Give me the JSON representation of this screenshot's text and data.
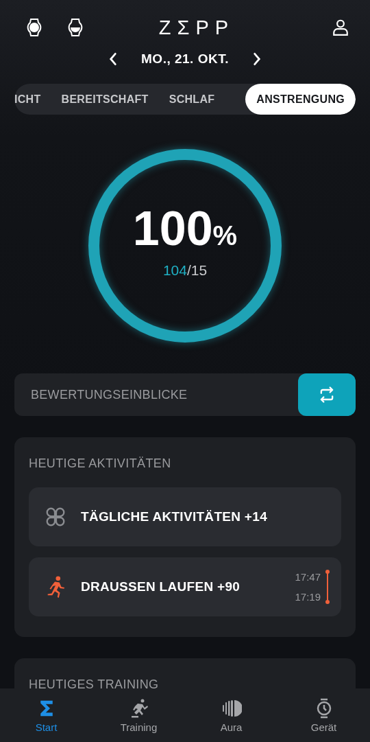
{
  "header": {
    "logo": "ZΣPP",
    "date": "MO., 21. OKT."
  },
  "tabs": [
    {
      "label": "ICHT",
      "selected": false
    },
    {
      "label": "BEREITSCHAFT",
      "selected": false
    },
    {
      "label": "SCHLAF",
      "selected": false
    },
    {
      "label": "ANSTRENGUNG",
      "selected": true
    }
  ],
  "score": {
    "percent": "100",
    "unit": "%",
    "current": "104",
    "target": "/15",
    "level": 1
  },
  "insights": {
    "label": "BEWERTUNGSEINBLICKE"
  },
  "activities": {
    "title": "HEUTIGE AKTIVITÄTEN",
    "items": [
      {
        "kind": "daily",
        "label": "TÄGLICHE AKTIVITÄTEN +14"
      },
      {
        "kind": "run",
        "label": "DRAUSSEN LAUFEN +90",
        "end": "17:47",
        "start": "17:19"
      }
    ]
  },
  "training": {
    "title": "HEUTIGES TRAINING"
  },
  "nav": [
    {
      "label": "Start",
      "selected": true
    },
    {
      "label": "Training",
      "selected": false
    },
    {
      "label": "Aura",
      "selected": false
    },
    {
      "label": "Gerät",
      "selected": false
    }
  ]
}
